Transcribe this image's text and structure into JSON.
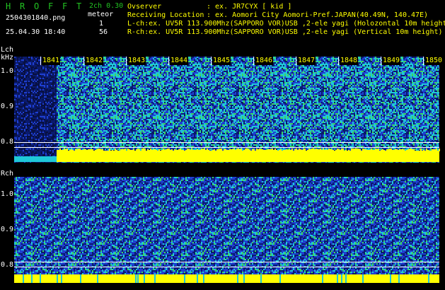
{
  "header": {
    "logo_letters": [
      "H",
      "R",
      "O",
      "F",
      "F",
      "T"
    ],
    "filename": "2504301840.png",
    "datetime": "25.04.30 18:40",
    "mode": "2ch 0.30",
    "meteor_label": "meteor",
    "meteor_count_l": "1",
    "meteor_count_r": "56",
    "observer_key": "Ovserver",
    "observer_value": ": ex. JR7CYX [ kid ]",
    "location_key": "Receiving Location",
    "location_value": ": ex. Aomori City Aomori-Pref.JAPAN(40.49N, 140.47E)",
    "lch_line": "L-ch:ex. UV5R 113.900Mhz(SAPPORO VOR)USB ,2-ele yagi (Holozontal 10m height)",
    "rch_line": "R-ch:ex. UV5R 113.900Mhz(SAPPORO VOR)USB ,2-ele yagi (Vertical 10m height)"
  },
  "lch": {
    "title": "Lch",
    "unit": "kHz",
    "y_labels": [
      "1.0",
      "0.9",
      "0.8"
    ],
    "time_labels": [
      "1841",
      "1842",
      "1843",
      "1844",
      "1845",
      "1846",
      "1847",
      "1848",
      "1849",
      "1850"
    ]
  },
  "rch": {
    "title": "Rch",
    "y_labels": [
      "1.0",
      "0.9",
      "0.8"
    ]
  },
  "colors": {
    "noise_dark": "#0a1a6e",
    "noise_blue": "#1f3fd0",
    "noise_cyan": "#1fc8d8",
    "noise_green": "#3cd460",
    "signal_yellow": "#ffff00",
    "grid": "#ffffff"
  }
}
